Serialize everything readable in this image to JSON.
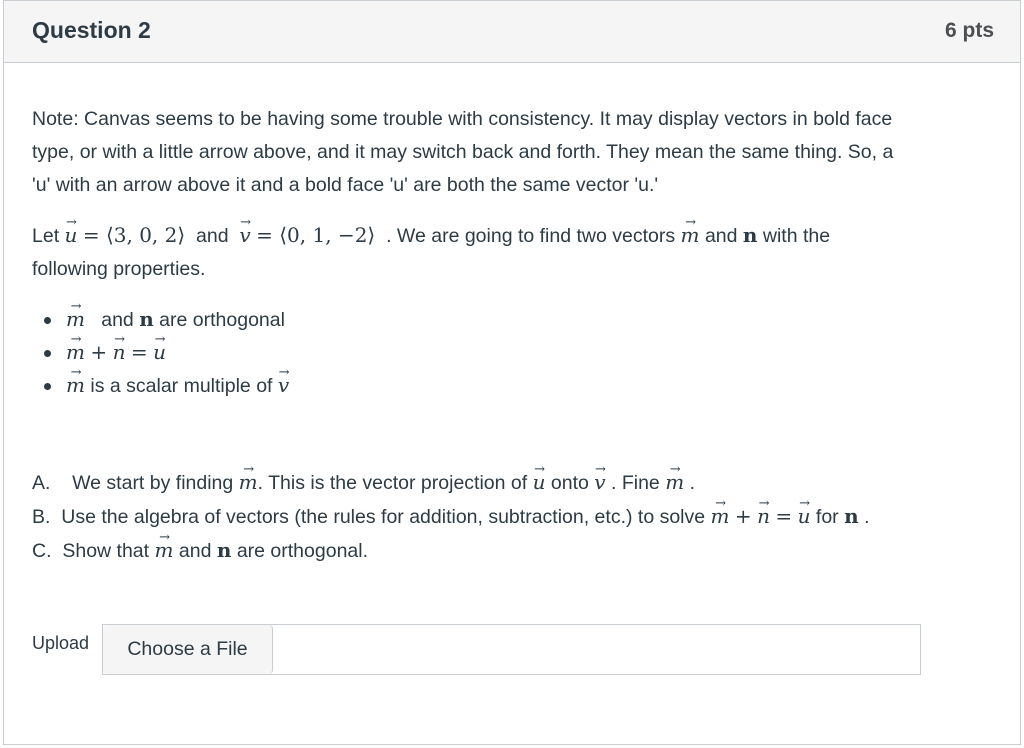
{
  "question": {
    "title": "Question 2",
    "points": "6 pts"
  },
  "note": {
    "line1": "Note: Canvas seems to be having some trouble with consistency. It may display vectors in bold face",
    "line2": "type, or with a little arrow above, and it may switch back and forth. They mean the same thing. So,  a",
    "line3": "'u' with an arrow above it and a bold face 'u' are both the same vector 'u.'"
  },
  "intro": {
    "let": "Let",
    "u_value": "= ⟨3, 0, 2⟩",
    "and": "and",
    "v_value": "= ⟨0, 1, −2⟩",
    "sentence": ". We are going to find two vectors",
    "and2": "and",
    "with_the": "with the",
    "line2": "following properties."
  },
  "properties": [
    {
      "text": "and",
      "tail": "are orthogonal"
    },
    {
      "text": "+",
      "eq": "="
    },
    {
      "text": "is a scalar multiple of"
    }
  ],
  "steps": {
    "a_label": "A.",
    "a_text1": "We start by finding",
    "a_text2": ". This is the vector projection of",
    "a_text3": "onto",
    "a_text4": ".  Fine",
    "a_text5": ".",
    "b_label": "B.",
    "b_text1": "Use the algebra of vectors (the rules for addition, subtraction, etc.) to solve",
    "b_plus": "+",
    "b_eq": "=",
    "b_text2": "for",
    "b_text3": ".",
    "c_label": "C.",
    "c_text1": "Show that",
    "c_text2": "and",
    "c_text3": "are orthogonal."
  },
  "symbols": {
    "m": "m",
    "n": "n",
    "u": "u",
    "v": "v",
    "bold_n": "n"
  },
  "upload": {
    "label": "Upload",
    "button": "Choose a File",
    "filename": ""
  }
}
